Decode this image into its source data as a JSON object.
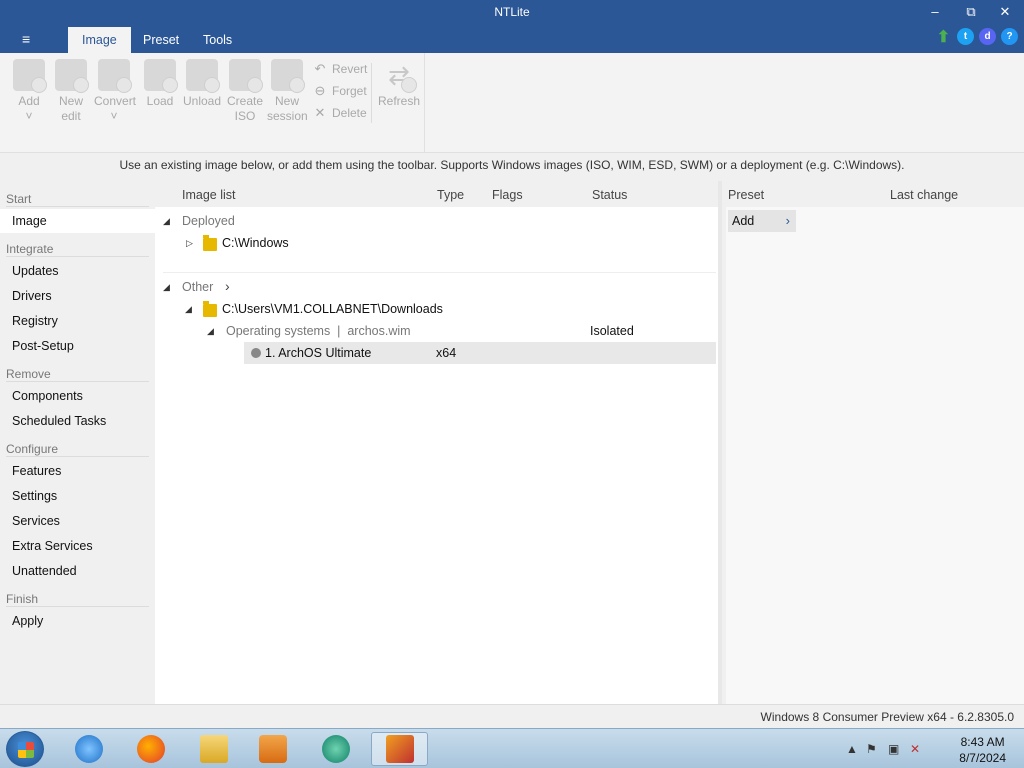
{
  "window": {
    "title": "NTLite"
  },
  "menu": {
    "icon": "hamburger-icon",
    "glyph": "≡"
  },
  "tabs": [
    {
      "label": "Image",
      "active": true
    },
    {
      "label": "Preset",
      "active": false
    },
    {
      "label": "Tools",
      "active": false
    }
  ],
  "top_icons": [
    {
      "name": "update-arrow-icon",
      "color": "#4caf50"
    },
    {
      "name": "twitter-icon",
      "color": "#1da1f2"
    },
    {
      "name": "discord-icon",
      "color": "#5865f2"
    },
    {
      "name": "help-icon",
      "color": "#2196f3"
    }
  ],
  "ribbon": {
    "buttons": [
      {
        "label": "Add",
        "sub": "˅",
        "icon": "add-image-icon"
      },
      {
        "label": "New",
        "sub": "edit",
        "icon": "new-edit-icon"
      },
      {
        "label": "Convert",
        "sub": "˅",
        "icon": "convert-icon"
      },
      {
        "label": "Load",
        "sub": "",
        "icon": "load-icon"
      },
      {
        "label": "Unload",
        "sub": "",
        "icon": "unload-icon"
      },
      {
        "label": "Create",
        "sub": "ISO",
        "icon": "create-iso-icon"
      },
      {
        "label": "New",
        "sub": "session",
        "icon": "new-session-icon"
      }
    ],
    "small_buttons": [
      {
        "label": "Revert",
        "glyph": "↶",
        "icon": "revert-icon"
      },
      {
        "label": "Forget",
        "glyph": "⊖",
        "icon": "forget-icon"
      },
      {
        "label": "Delete",
        "glyph": "✕",
        "icon": "delete-icon"
      }
    ],
    "refresh": {
      "label": "Refresh",
      "icon": "refresh-icon"
    }
  },
  "info": "Use an existing image below, or add them using the toolbar. Supports Windows images (ISO, WIM, ESD, SWM) or a deployment (e.g. C:\\Windows).",
  "sidebar": {
    "groups": [
      {
        "title": "Start",
        "items": [
          "Image"
        ]
      },
      {
        "title": "Integrate",
        "items": [
          "Updates",
          "Drivers",
          "Registry",
          "Post-Setup"
        ]
      },
      {
        "title": "Remove",
        "items": [
          "Components",
          "Scheduled Tasks"
        ]
      },
      {
        "title": "Configure",
        "items": [
          "Features",
          "Settings",
          "Services",
          "Extra Services",
          "Unattended"
        ]
      },
      {
        "title": "Finish",
        "items": [
          "Apply"
        ]
      }
    ],
    "active": "Image"
  },
  "image_list": {
    "columns": [
      "Image list",
      "Type",
      "Flags",
      "Status"
    ],
    "deployed_label": "Deployed",
    "deployed_path": "C:\\Windows",
    "other_label": "Other",
    "other_path": "C:\\Users\\VM1.COLLABNET\\Downloads",
    "os_group": "Operating systems  |  archos.wim",
    "os_group_status": "Isolated",
    "edition": "1. ArchOS Ultimate",
    "edition_type": "x64"
  },
  "preset": {
    "columns": [
      "Preset",
      "Last change"
    ],
    "add_label": "Add"
  },
  "status": "Windows 8 Consumer Preview x64 - 6.2.8305.0",
  "taskbar": {
    "apps": [
      "internet-explorer-icon",
      "firefox-icon",
      "file-explorer-icon",
      "media-player-icon",
      "other-app-icon",
      "ntlite-icon"
    ],
    "time": "8:43 AM",
    "date": "8/7/2024"
  }
}
